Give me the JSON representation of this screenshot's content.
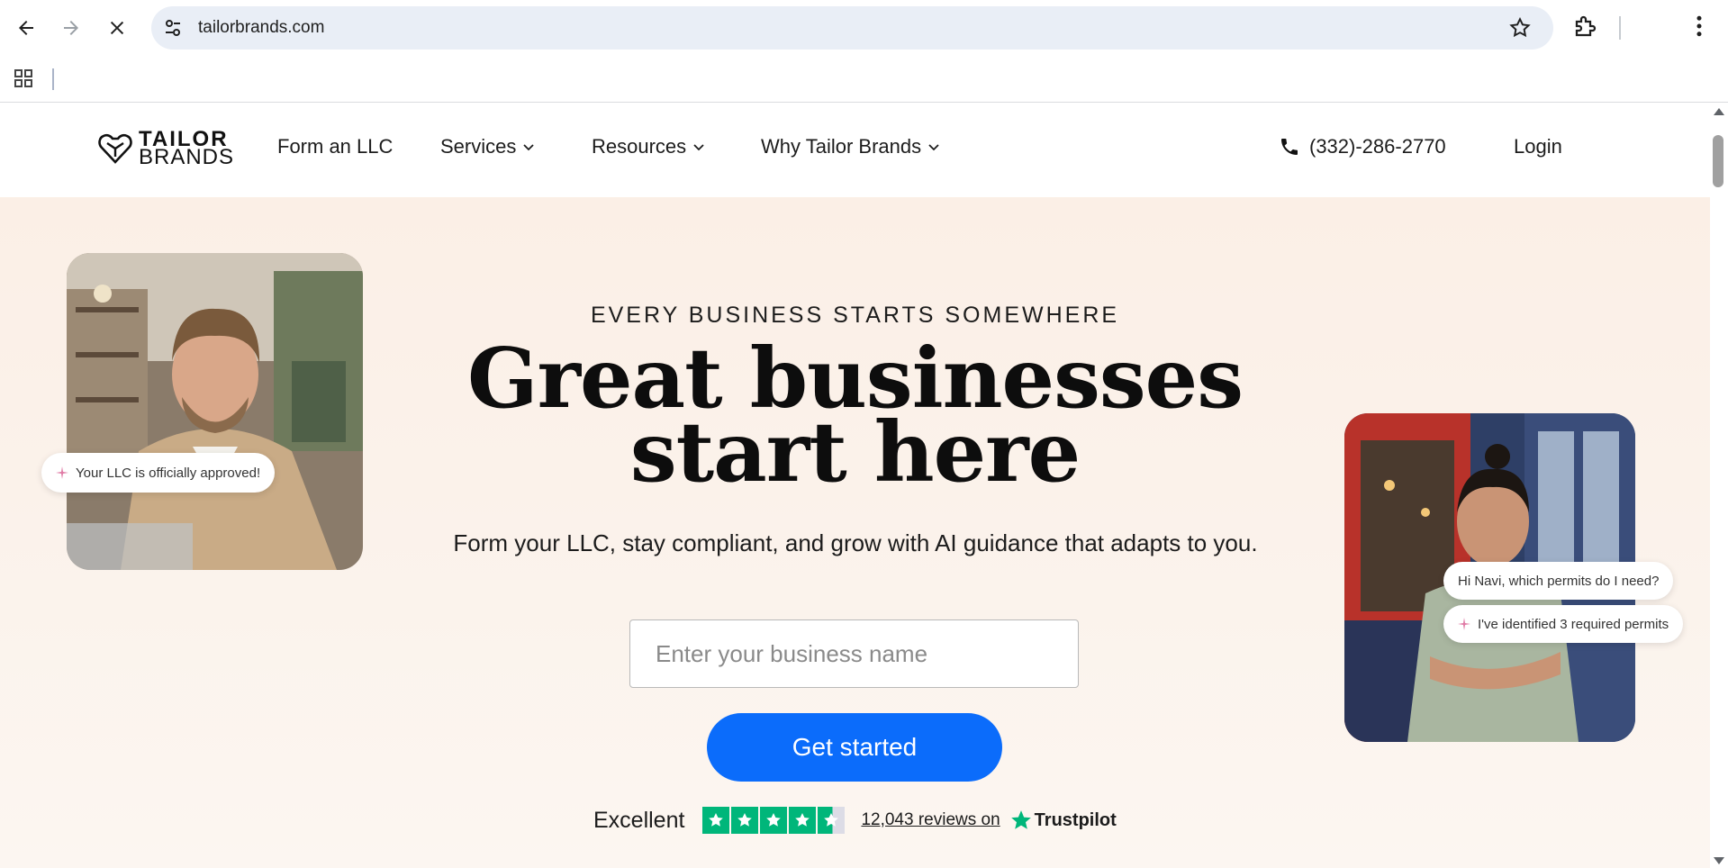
{
  "browser": {
    "url": "tailorbrands.com",
    "stop_icon": "close-icon"
  },
  "site": {
    "logo": {
      "line1": "TAILOR",
      "line2": "BRANDS"
    },
    "nav": [
      {
        "label": "Form an LLC",
        "has_dropdown": false
      },
      {
        "label": "Services",
        "has_dropdown": true
      },
      {
        "label": "Resources",
        "has_dropdown": true
      },
      {
        "label": "Why Tailor Brands",
        "has_dropdown": true
      }
    ],
    "phone": "(332)-286-2770",
    "login": "Login"
  },
  "hero": {
    "kicker": "EVERY BUSINESS STARTS SOMEWHERE",
    "headline_line1": "Great businesses",
    "headline_line2": "start here",
    "subhead": "Form your LLC, stay compliant, and grow with AI guidance that adapts to you.",
    "input_placeholder": "Enter your business name",
    "cta": "Get started",
    "rating": {
      "label": "Excellent",
      "stars": 4.5,
      "reviews": "12,043 reviews on",
      "provider": "Trustpilot"
    },
    "left_card_message": "Your LLC is officially approved!",
    "right_card_question": "Hi Navi, which permits do I need?",
    "right_card_answer": "I've identified 3 required permits"
  },
  "colors": {
    "accent": "#0b6cfb",
    "trustpilot_green": "#00b67a",
    "hero_bg": "#fbf1e8"
  }
}
